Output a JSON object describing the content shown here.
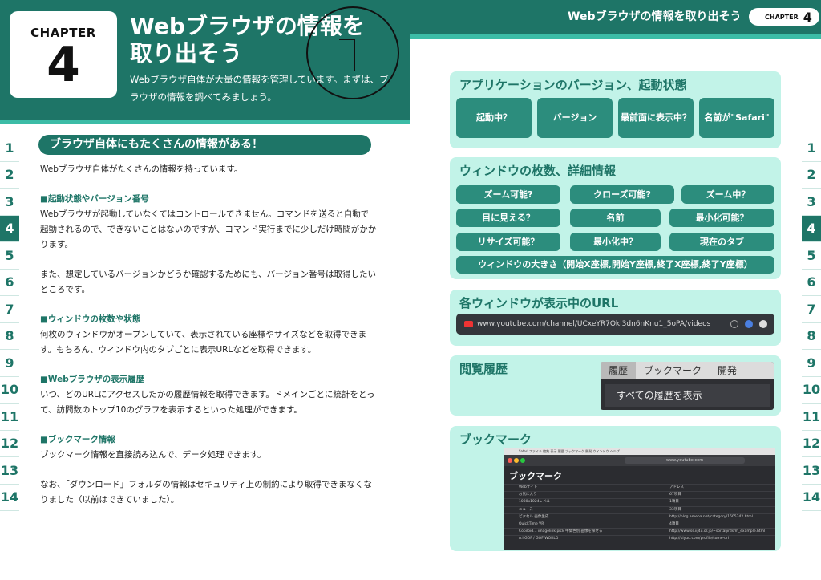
{
  "left_page": {
    "chapter_label": "CHAPTER",
    "chapter_number": "4",
    "title_line1": "Webブラウザの情報を",
    "title_line2": "取り出そう",
    "lead_line1": "Webブラウザ自体が大量の情報を管理しています。まずは、ブ",
    "lead_line2": "ラウザの情報を調べてみましょう。",
    "section_heading": "ブラウザ自体にもたくさんの情報がある！",
    "paragraphs": [
      "Webブラウザ自体がたくさんの情報を持っています。",
      "■起動状態やバージョン番号",
      "Webブラウザが起動していなくてはコントロールできません。コマンドを送ると自動で起動されるので、できないことはないのですが、コマンド実行までに少しだけ時間がかかります。",
      "また、想定しているバージョンかどうか確認するためにも、バージョン番号は取得したいところです。",
      "■ウィンドウの枚数や状態",
      "何枚のウィンドウがオープンしていて、表示されている座標やサイズなどを取得できます。もちろん、ウィンドウ内のタブごとに表示URLなどを取得できます。",
      "■Webブラウザの表示履歴",
      "いつ、どのURLにアクセスしたかの履歴情報を取得できます。ドメインごとに統計をとって、訪問数のトップ10のグラフを表示するといった処理ができます。",
      "■ブックマーク情報",
      "ブックマーク情報を直接読み込んで、データ処理できます。",
      "なお、「ダウンロード」フォルダの情報はセキュリティ上の制約により取得できまなくなりました（以前はできていました）。"
    ]
  },
  "side_tabs": [
    "1",
    "2",
    "3",
    "4",
    "5",
    "6",
    "7",
    "8",
    "9",
    "10",
    "11",
    "12",
    "13",
    "14"
  ],
  "active_tab": "4",
  "right_page": {
    "running_title": "Webブラウザの情報を取り出そう",
    "chapter_label": "CHAPTER",
    "chapter_number": "4",
    "app_panel": {
      "title": "アプリケーションのバージョン、起動状態",
      "buttons": [
        "起動中？",
        "バージョン",
        "最前面に表示中？",
        "名前が\"Safari\""
      ]
    },
    "window_panel": {
      "title": "ウィンドウの枚数、詳細情報",
      "buttons": [
        "ズーム可能?",
        "クローズ可能?",
        "ズーム中？",
        "目に見える？",
        "名前",
        "最小化可能？",
        "リサイズ可能？",
        "最小化中？",
        "現在のタブ",
        "ウィンドウの大きさ（開始X座標,開始Y座標,終了X座標,終了Y座標）"
      ]
    },
    "url_panel": {
      "title": "各ウィンドウが表示中のURL",
      "url": "www.youtube.com/channel/UCxeYR7Okl3dn6nKnu1_5oPA/videos"
    },
    "history_panel": {
      "title": "閲覧履歴",
      "menu": [
        "履歴",
        "ブックマーク",
        "開発"
      ],
      "item": "すべての履歴を表示"
    },
    "bookmark_panel": {
      "title": "ブックマーク",
      "menubar": "Safari  ファイル  編集  表示  履歴  ブックマーク  開発  ウインドウ  ヘルプ",
      "address": "www.youtube.com",
      "heading": "ブックマーク",
      "rows": [
        {
          "name": "Webサイト",
          "addr": "アドレス"
        },
        {
          "name": "お気に入り",
          "addr": "67項目"
        },
        {
          "name": "1080x1024レベル",
          "addr": "1項目"
        },
        {
          "name": "ニュース",
          "addr": "33項目"
        },
        {
          "name": "ピクセル 画像生成…",
          "addr": "http://blog.ameba.net/category/1605342.html"
        },
        {
          "name": "QuickTime VR",
          "addr": "4項目"
        },
        {
          "name": "Copiloid… imagelink pick 中間色別 画像を探せる",
          "addr": "http://www.ss.iij4u.or.jp/~sortaljirds/m_example.html"
        },
        {
          "name": "A.I.GOF / GOF WORLD",
          "addr": "http://kiyuu.com/profile/some-url"
        }
      ]
    }
  }
}
